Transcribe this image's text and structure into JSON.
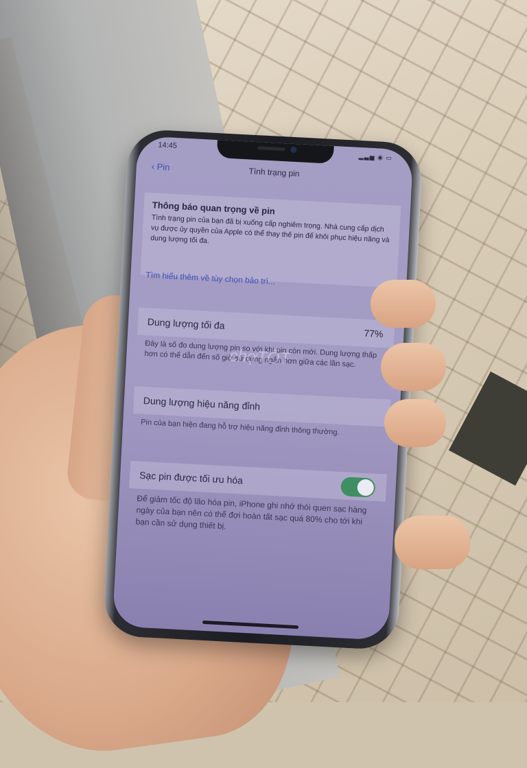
{
  "status_bar": {
    "time": "14:45",
    "icons": "▂▃▅ ◉ ▭"
  },
  "nav": {
    "back_label": "Pin",
    "title": "Tình trạng pin"
  },
  "notice": {
    "title": "Thông báo quan trọng về pin",
    "body": "Tình trạng pin của bạn đã bị xuống cấp nghiêm trọng. Nhà cung cấp dịch vụ được ủy quyền của Apple có thể thay thế pin để khôi phục hiệu năng và dung lượng tối đa.",
    "link": "Tìm hiểu thêm về tùy chọn bảo trì..."
  },
  "capacity": {
    "label": "Dung lượng tối đa",
    "value": "77%",
    "description": "Đây là số đo dung lượng pin so với khi pin còn mới. Dung lượng thấp hơn có thể dẫn đến số giờ sử dụng ngắn hơn giữa các lần sạc."
  },
  "performance": {
    "label": "Dung lượng hiệu năng đỉnh",
    "description": "Pin của bạn hiện đang hỗ trợ hiệu năng đỉnh thông thường."
  },
  "optimized_charging": {
    "label": "Sạc pin được tối ưu hóa",
    "enabled": true,
    "description": "Để giảm tốc độ lão hóa pin, iPhone ghi nhớ thói quen sạc hàng ngày của bạn nên có thể đợi hoàn tất sạc quá 80% cho tới khi bạn cần sử dụng thiết bị."
  },
  "watermark": "chợTỐT",
  "colors": {
    "toggle_on": "#3f8f63",
    "link": "#3d4fb8",
    "screen_tint": "#a49dc4"
  }
}
